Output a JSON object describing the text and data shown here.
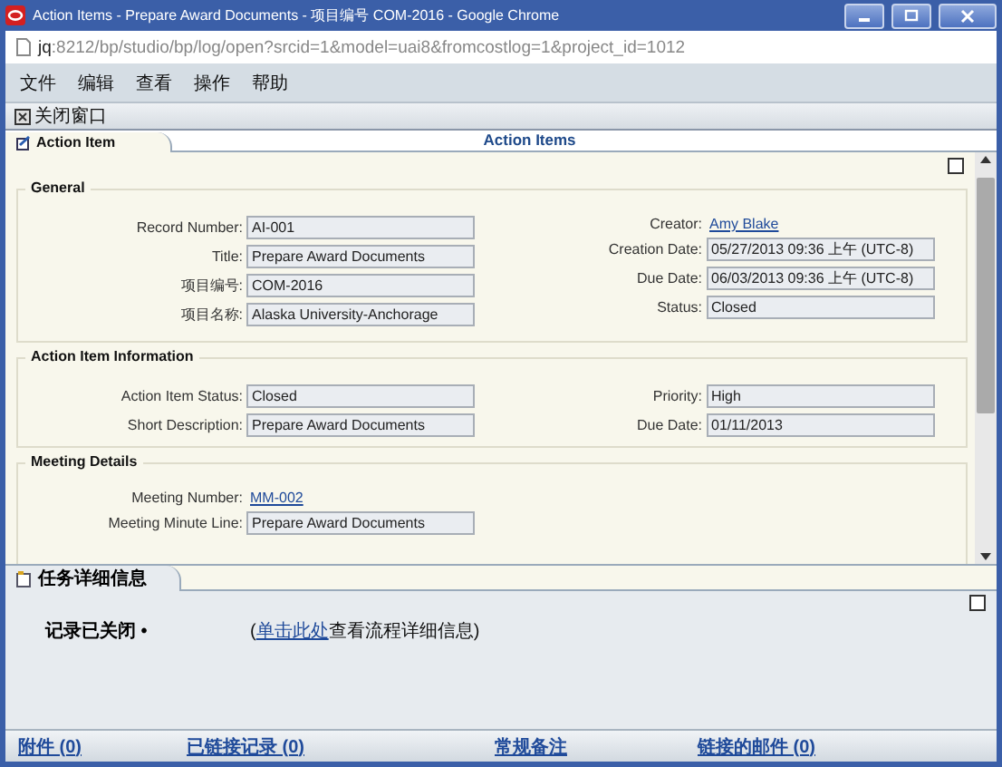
{
  "window": {
    "title": "Action Items - Prepare Award Documents - 项目编号  COM-2016 - Google Chrome"
  },
  "address_bar": {
    "host": "jq",
    "path": ":8212/bp/studio/bp/log/open?srcid=1&model=uai8&fromcostlog=1&project_id=1012"
  },
  "menu": [
    "文件",
    "编辑",
    "查看",
    "操作",
    "帮助"
  ],
  "toolbar": [
    {
      "label": "关闭窗口"
    }
  ],
  "tabs": [
    {
      "label": "Action Item",
      "selected": true
    }
  ],
  "page_title": "Action Items",
  "sections": [
    {
      "title": "General",
      "left": [
        {
          "label": "Record Number:",
          "value": "AI-001",
          "kind": "field"
        },
        {
          "label": "Title:",
          "value": "Prepare Award Documents",
          "kind": "field"
        },
        {
          "label": "项目编号:",
          "value": "COM-2016",
          "kind": "field"
        },
        {
          "label": "项目名称:",
          "value": "Alaska University-Anchorage",
          "kind": "field"
        }
      ],
      "right": [
        {
          "label": "Creator:",
          "value": "Amy Blake",
          "kind": "link"
        },
        {
          "label": "Creation Date:",
          "value": "05/27/2013 09:36 上午 (UTC-8)",
          "kind": "field"
        },
        {
          "label": "Due Date:",
          "value": "06/03/2013 09:36 上午 (UTC-8)",
          "kind": "field"
        },
        {
          "label": "Status:",
          "value": "Closed",
          "kind": "field"
        }
      ]
    },
    {
      "title": "Action Item Information",
      "left": [
        {
          "label": "Action Item Status:",
          "value": "Closed",
          "kind": "field"
        },
        {
          "label": "Short Description:",
          "value": "Prepare Award Documents",
          "kind": "field"
        }
      ],
      "right": [
        {
          "label": "Priority:",
          "value": "High",
          "kind": "field"
        },
        {
          "label": "Due Date:",
          "value": "01/11/2013",
          "kind": "field"
        }
      ]
    },
    {
      "title": "Meeting Details",
      "left": [
        {
          "label": "Meeting Number:",
          "value": "MM-002",
          "kind": "link"
        },
        {
          "label": "Meeting Minute Line:",
          "value": "Prepare Award Documents",
          "kind": "field"
        }
      ]
    }
  ],
  "detail_panel": {
    "tab": "任务详细信息",
    "status": "记录已关闭 •",
    "note_prefix": "(",
    "note_link": "单击此处",
    "note_suffix": "查看流程详细信息)"
  },
  "footer_links": [
    "附件 (0)",
    "已链接记录 (0)",
    "常规备注",
    "链接的邮件 (0)"
  ]
}
